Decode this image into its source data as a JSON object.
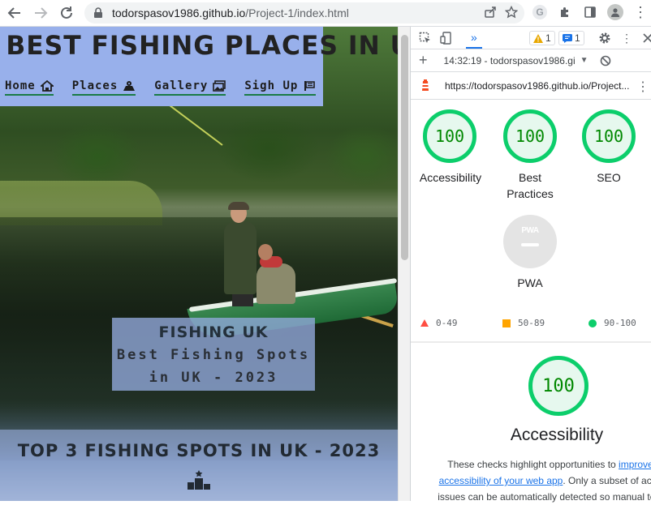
{
  "browser": {
    "url_host": "todorspasov1986.github.io",
    "url_path": "/Project-1/index.html"
  },
  "site": {
    "title": "BEST FISHING PLACES IN UK",
    "nav": [
      {
        "label": "Home",
        "icon": "house-icon"
      },
      {
        "label": "Places",
        "icon": "map-pins-icon"
      },
      {
        "label": "Gallery",
        "icon": "images-icon"
      },
      {
        "label": "Sigh Up",
        "icon": "flag-icon"
      }
    ],
    "hero": {
      "title": "FISHING UK",
      "subtitle_line1": "Best Fishing Spots",
      "subtitle_line2": "in UK - 2023"
    },
    "section_title": "TOP 3 FISHING SPOTS IN UK - 2023",
    "section_icon": "podium-icon"
  },
  "devtools": {
    "more_tabs": "»",
    "warning_count": "1",
    "info_count": "1",
    "session": "14:32:19 - todorspasov1986.gi",
    "report_url": "https://todorspasov1986.github.io/Project...",
    "scores": [
      {
        "label": "Accessibility",
        "value": "100"
      },
      {
        "label": "Best Practices",
        "value": "100"
      },
      {
        "label": "SEO",
        "value": "100"
      }
    ],
    "pwa": {
      "label": "PWA",
      "badge": "PWA"
    },
    "legend": [
      {
        "range": "0-49",
        "color": "#ff4e42"
      },
      {
        "range": "50-89",
        "color": "#ffa400"
      },
      {
        "range": "90-100",
        "color": "#0cce6b"
      }
    ],
    "category": {
      "score": "100",
      "title": "Accessibility",
      "desc_start": "These checks highlight opportunities to ",
      "link1": "improve",
      "link2": "accessibility of your web app",
      "desc_mid": ". Only a subset of acce",
      "desc_end": "issues can be automatically detected so manual test"
    }
  }
}
